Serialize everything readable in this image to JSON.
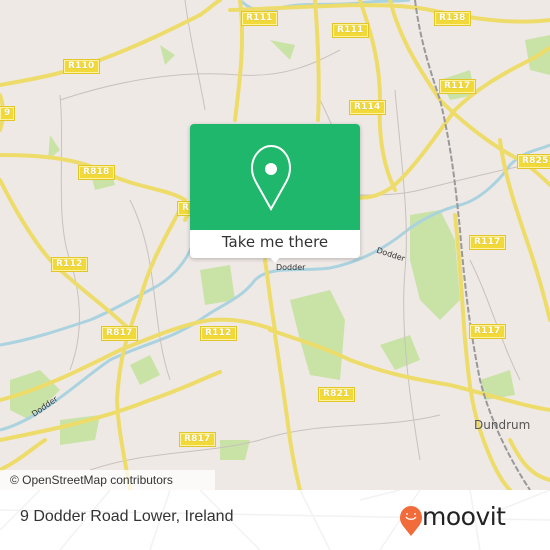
{
  "map": {
    "road_labels": [
      {
        "id": "r111-a",
        "text": "R111"
      },
      {
        "id": "r111-b",
        "text": "R111"
      },
      {
        "id": "r138",
        "text": "R138"
      },
      {
        "id": "r110",
        "text": "R110"
      },
      {
        "id": "r117-a",
        "text": "R117"
      },
      {
        "id": "r114",
        "text": "R114"
      },
      {
        "id": "r825",
        "text": "R825"
      },
      {
        "id": "r818",
        "text": "R818"
      },
      {
        "id": "r-partial",
        "text": "R"
      },
      {
        "id": "r117-b",
        "text": "R117"
      },
      {
        "id": "r112-a",
        "text": "R112"
      },
      {
        "id": "r817-a",
        "text": "R817"
      },
      {
        "id": "r112-b",
        "text": "R112"
      },
      {
        "id": "r117-c",
        "text": "R117"
      },
      {
        "id": "r821",
        "text": "R821"
      },
      {
        "id": "r817-b",
        "text": "R817"
      },
      {
        "id": "r-9",
        "text": "9"
      }
    ],
    "river_labels": [
      "Dodder",
      "Dodder",
      "Dodder"
    ],
    "place_labels": [
      "Dundrum"
    ],
    "attribution": "© OpenStreetMap contributors",
    "colors": {
      "land": "#efe9e6",
      "road": "#f6e06a",
      "park": "#c9e3a7",
      "river": "#aad3df",
      "rail": "#999999"
    }
  },
  "popup": {
    "icon": "location-pin-icon",
    "cta_label": "Take me there",
    "accent": "#1fb76b"
  },
  "footer": {
    "address": "9 Dodder Road Lower, Ireland",
    "brand": "moovit",
    "brand_color": "#f26b3a"
  }
}
